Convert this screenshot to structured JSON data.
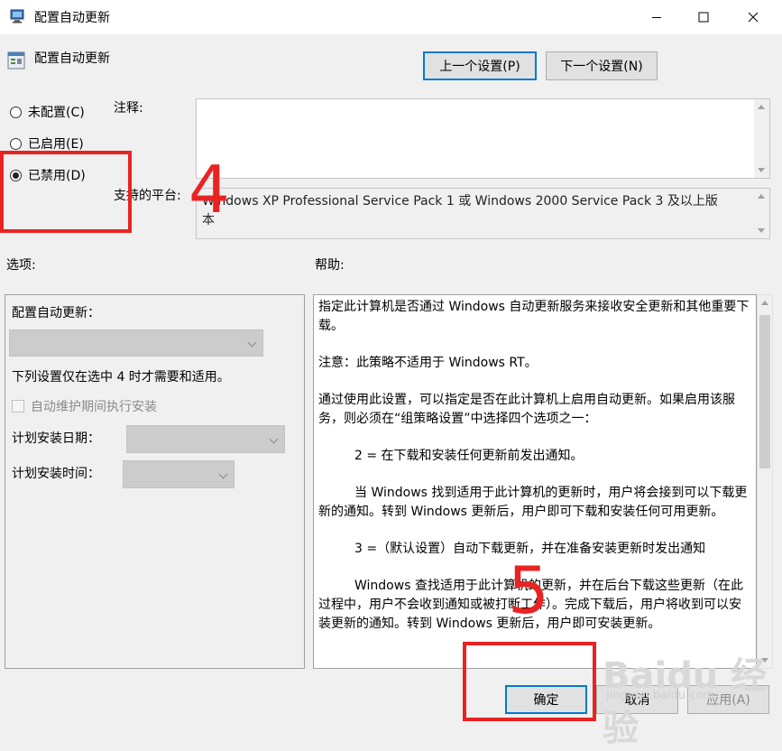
{
  "window": {
    "title": "配置自动更新"
  },
  "header": {
    "title": "配置自动更新",
    "prev_button": "上一个设置(P)",
    "next_button": "下一个设置(N)"
  },
  "state": {
    "options": [
      {
        "label": "未配置(C)",
        "selected": false
      },
      {
        "label": "已启用(E)",
        "selected": false
      },
      {
        "label": "已禁用(D)",
        "selected": true
      }
    ]
  },
  "comment": {
    "label": "注释:",
    "value": ""
  },
  "platform": {
    "label": "支持的平台:",
    "value_line1": "Windows XP Professional Service Pack 1 或 Windows 2000 Service Pack 3 及以上版",
    "value_line2": "本"
  },
  "options_panel": {
    "heading": "选项:",
    "configure_label": "配置自动更新：",
    "configure_value": "",
    "note": "下列设置仅在选中 4 时才需要和适用。",
    "maintenance_checkbox": "自动维护期间执行安装",
    "day_label": "计划安装日期：",
    "day_value": "",
    "time_label": "计划安装时间：",
    "time_value": ""
  },
  "help_panel": {
    "heading": "帮助:",
    "paragraphs": [
      "指定此计算机是否通过 Windows 自动更新服务来接收安全更新和其他重要下载。",
      "注意：此策略不适用于 Windows RT。",
      "通过使用此设置，可以指定是否在此计算机上启用自动更新。如果启用该服务，则必须在“组策略设置”中选择四个选项之一：",
      "2 = 在下载和安装任何更新前发出通知。",
      "当 Windows 找到适用于此计算机的更新时，用户将会接到可以下载更新的通知。转到 Windows 更新后，用户即可下载和安装任何可用更新。",
      "3 =（默认设置）自动下载更新，并在准备安装更新时发出通知",
      "Windows 查找适用于此计算机的更新，并在后台下载这些更新（在此过程中，用户不会收到通知或被打断工作）。完成下载后，用户将收到可以安装更新的通知。转到 Windows 更新后，用户即可安装更新。"
    ]
  },
  "footer": {
    "ok_button": "确定",
    "cancel_button": "取消",
    "apply_button": "应用(A)"
  },
  "annotations": {
    "step4": "4",
    "step5": "5",
    "watermark": "Baidu 经验",
    "watermark_url": "jingyan.baidu.com",
    "color": "#e82322"
  }
}
